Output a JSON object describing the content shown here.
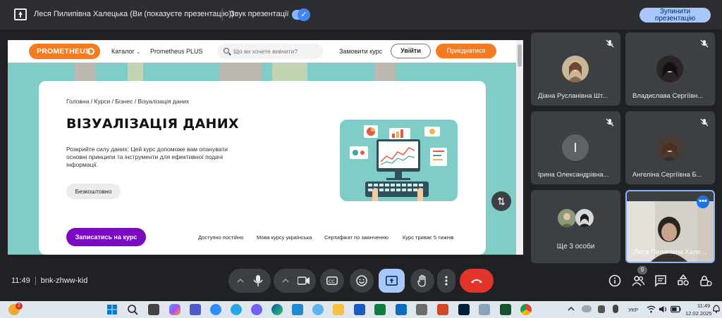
{
  "topbar": {
    "presenter_title": "Леся Пилипівна Халецька (Ви (показуєте презентацію))",
    "sound_label": "Звук презентації",
    "stop_button": "Зупинити презентацію"
  },
  "site": {
    "logo": "PROMETHEUS",
    "nav": {
      "catalog": "Каталог",
      "plus": "Prometheus PLUS",
      "search_placeholder": "Що ви хочете вивчити?",
      "order_course": "Замовити курс",
      "login": "Увійти",
      "join": "Приєднатися"
    },
    "breadcrumbs": "Головна / Курси / Бізнес / Візуалізація даних",
    "course_title": "ВІЗУАЛІЗАЦІЯ ДАНИХ",
    "course_desc": "Розкрийте силу даних: Цей курс допоможе вам опанувати основні принципи та інструменти для ефективної подачі інформації.",
    "free_button": "Безкоштовно",
    "enroll_button": "Записатись на курс",
    "facts": [
      "Доступно постійно",
      "Мова курсу українська",
      "Сертифікат по закінченню",
      "Курс триває 5 тижнів"
    ]
  },
  "participants": [
    {
      "name": "Діана Русланівна Шт..."
    },
    {
      "name": "Владислава Сергіївн..."
    },
    {
      "name": "Ірина Олександрівна...",
      "initial": "І"
    },
    {
      "name": "Ангеліна Сергіївна Б..."
    },
    {
      "name": "Ще 3 особи"
    },
    {
      "name": "Леся Пилипівна Хале..."
    }
  ],
  "meeting": {
    "time": "11:49",
    "code": "bnk-zhww-kid",
    "people_count": "9"
  },
  "taskbar": {
    "notif_badge": "2",
    "language": "УКР",
    "clock_time": "11:49",
    "clock_date": "12.02.2025"
  },
  "colors": {
    "accent_orange": "#f47b20",
    "enroll_purple": "#7a0bc0",
    "teal": "#7fcdc6",
    "end_call_red": "#e1352c",
    "meet_blue": "#a8c7fa"
  }
}
